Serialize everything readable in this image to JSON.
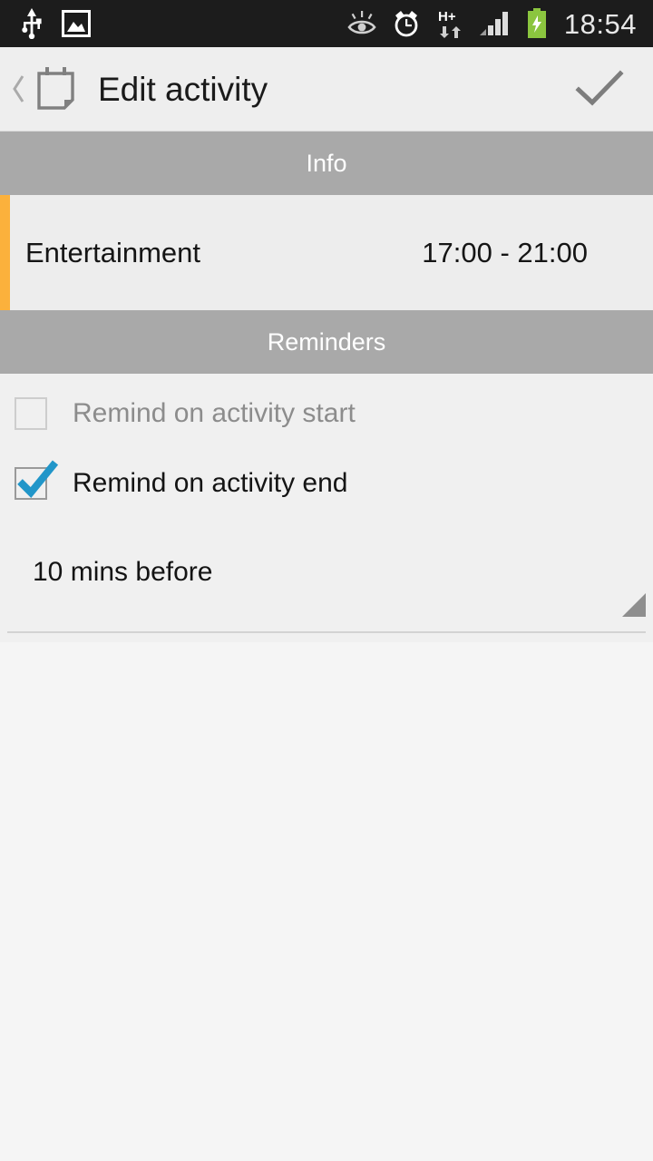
{
  "statusbar": {
    "time": "18:54",
    "left_icons": [
      "usb-icon",
      "screenshot-image-icon"
    ],
    "right_icons": [
      "smart-stay-eye-icon",
      "alarm-clock-icon",
      "hplus-data-icon",
      "signal-bars-icon",
      "battery-charging-icon"
    ],
    "network_label": "H+",
    "background_color": "#1c1c1c",
    "battery_color": "#8bc53f"
  },
  "actionbar": {
    "back_icon": "back-chevron-icon",
    "app_icon": "calendar-note-icon",
    "title": "Edit activity",
    "done_icon": "checkmark-icon",
    "background_color": "#eeeeee"
  },
  "sections": {
    "info": {
      "header": "Info",
      "accent_color": "#fbb13c",
      "activity_name": "Entertainment",
      "time_range": "17:00 - 21:00"
    },
    "reminders": {
      "header": "Reminders",
      "items": [
        {
          "label": "Remind on activity start",
          "checked": false,
          "enabled": false
        },
        {
          "label": "Remind on activity end",
          "checked": true,
          "enabled": true
        }
      ],
      "spinner": {
        "value": "10 mins before",
        "caret_icon": "spinner-caret-icon"
      }
    }
  },
  "colors": {
    "section_header_bg": "#a9a9a9",
    "checkbox_check": "#2196c9",
    "page_bg": "#f5f5f5"
  }
}
